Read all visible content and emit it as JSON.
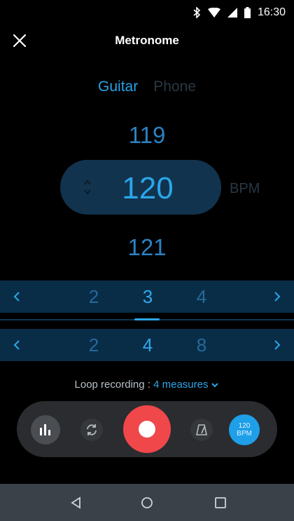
{
  "status_bar": {
    "time": "16:30",
    "icons": [
      "bluetooth-icon",
      "wifi-icon",
      "signal-icon",
      "battery-icon"
    ]
  },
  "header": {
    "title": "Metronome",
    "close_icon": "close-icon"
  },
  "tabs": [
    {
      "label": "Guitar",
      "active": true
    },
    {
      "label": "Phone",
      "active": false
    }
  ],
  "bpm": {
    "previous": "119",
    "current": "120",
    "next": "121",
    "unit": "BPM"
  },
  "beats_selector": {
    "values": [
      "2",
      "3",
      "4"
    ],
    "selected": "3"
  },
  "note_selector": {
    "values": [
      "2",
      "4",
      "8"
    ],
    "selected": "4"
  },
  "loop_recording": {
    "label": "Loop recording : ",
    "value": "4 measures"
  },
  "controls": {
    "bpm_badge_value": "120",
    "bpm_badge_unit": "BPM"
  },
  "colors": {
    "accent": "#2aa6ea",
    "record": "#f0474b",
    "background": "#000000"
  }
}
